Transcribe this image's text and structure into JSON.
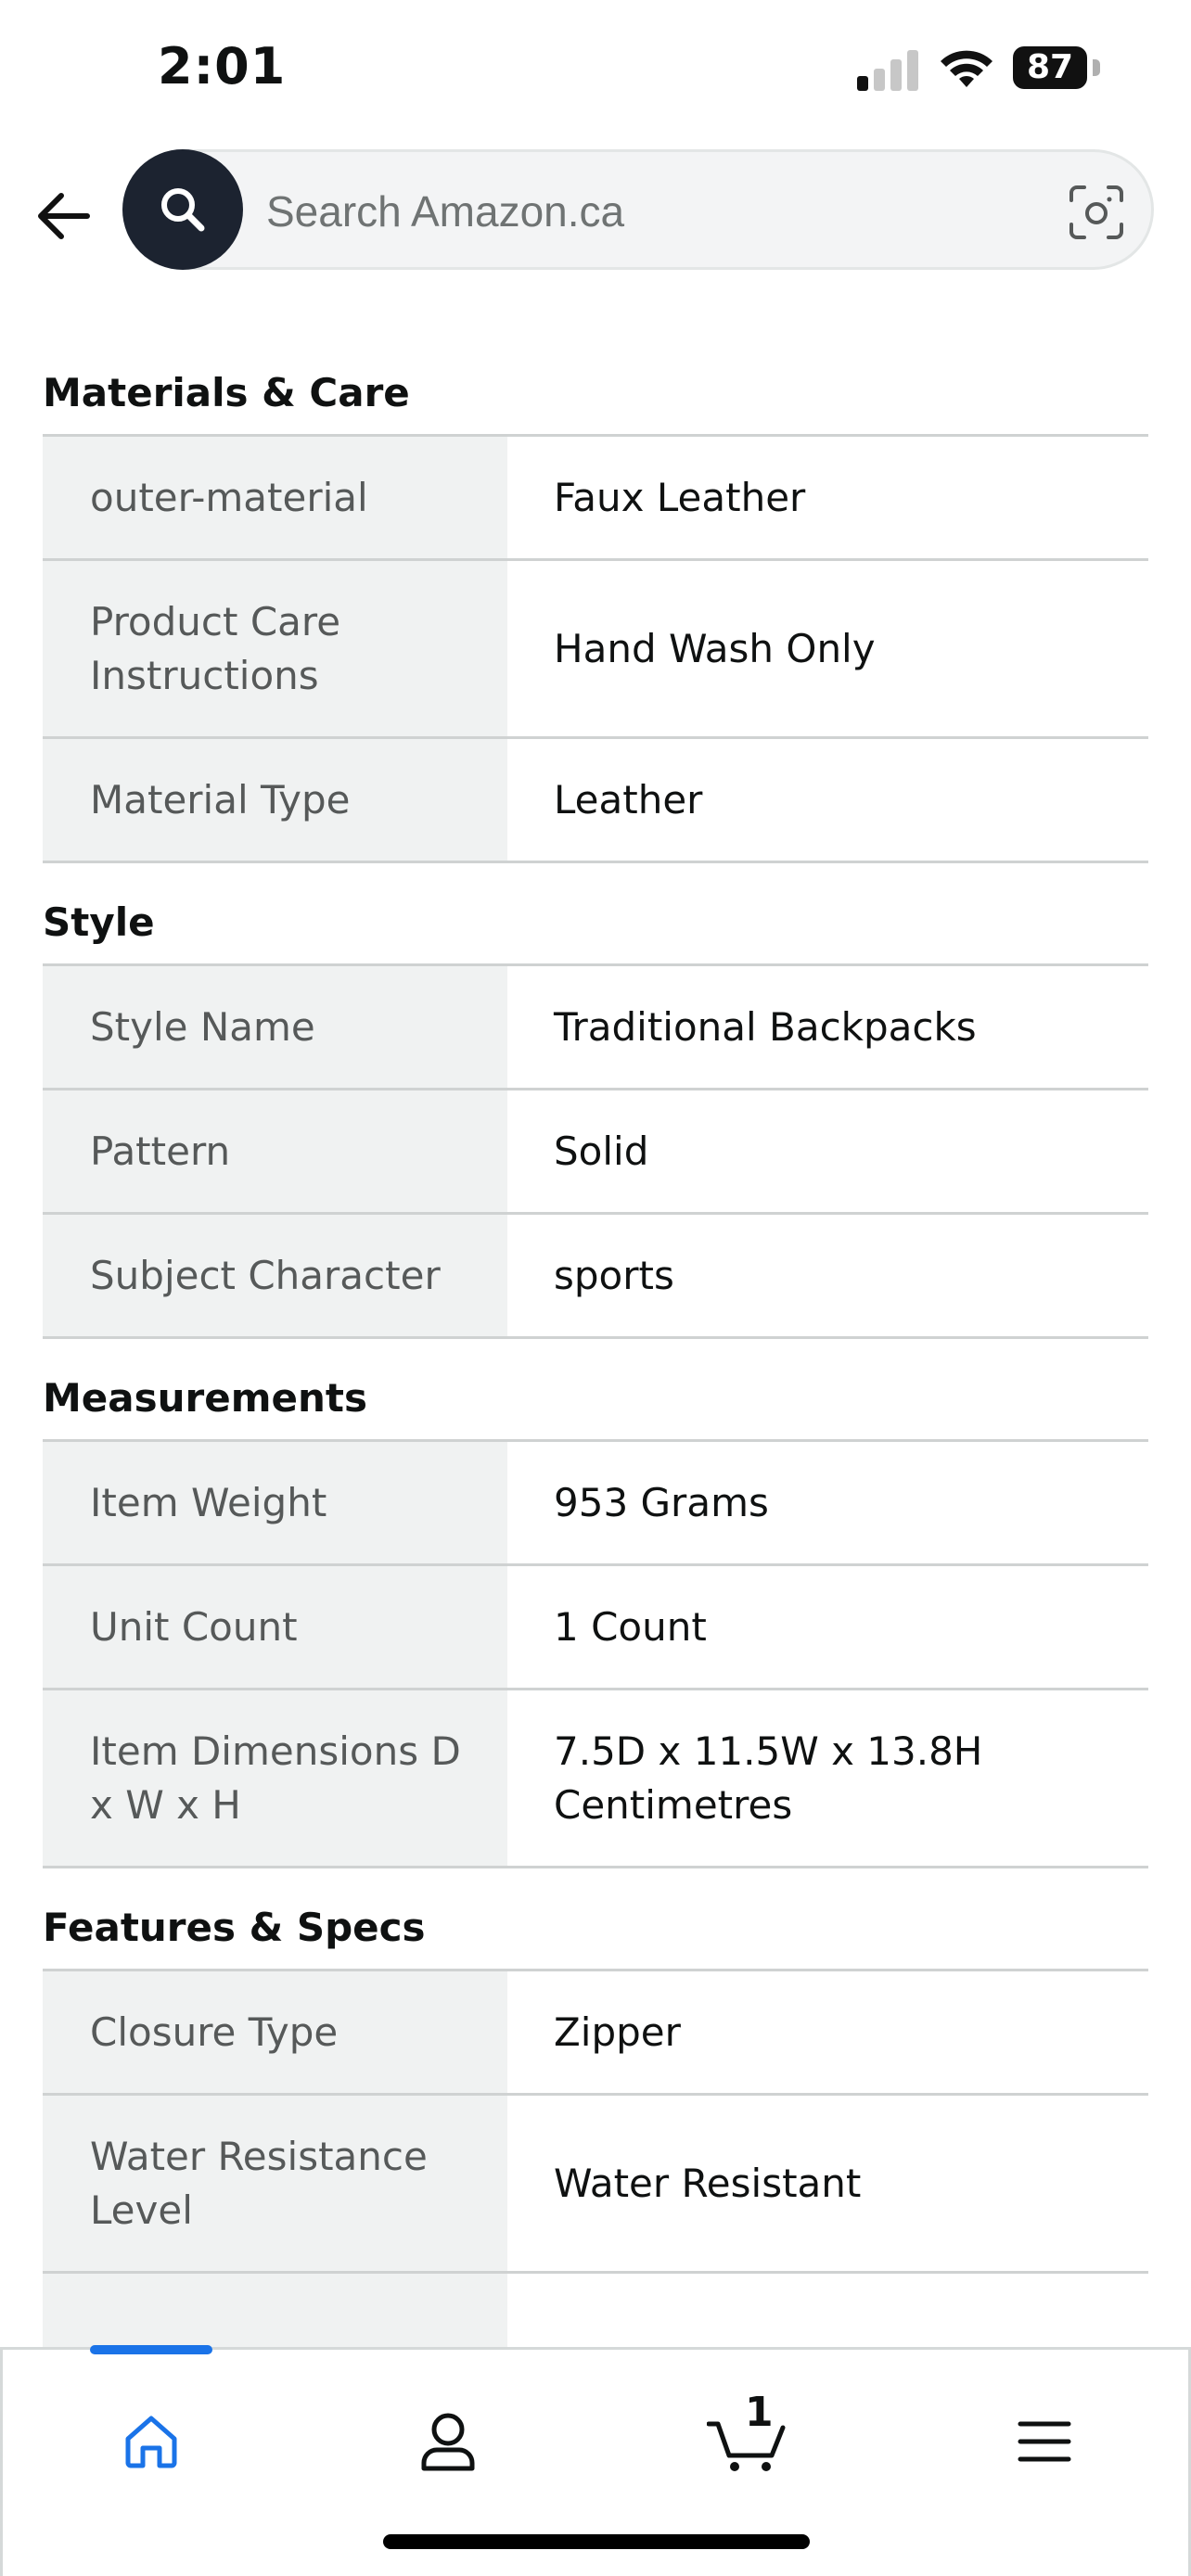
{
  "status_bar": {
    "time": "2:01",
    "battery": "87"
  },
  "search": {
    "placeholder": "Search Amazon.ca"
  },
  "sections": [
    {
      "title": "Materials & Care",
      "rows": [
        {
          "key": "outer-material",
          "value": "Faux Leather"
        },
        {
          "key": "Product Care Instructions",
          "value": "Hand Wash Only"
        },
        {
          "key": "Material Type",
          "value": "Leather"
        }
      ]
    },
    {
      "title": "Style",
      "rows": [
        {
          "key": "Style Name",
          "value": "Traditional Backpacks"
        },
        {
          "key": "Pattern",
          "value": "Solid"
        },
        {
          "key": "Subject Character",
          "value": "sports"
        }
      ]
    },
    {
      "title": "Measurements",
      "rows": [
        {
          "key": "Item Weight",
          "value": "953 Grams"
        },
        {
          "key": "Unit Count",
          "value": "1 Count"
        },
        {
          "key": "Item Dimensions D x W x H",
          "value": "7.5D x 11.5W x 13.8H Centimetres"
        }
      ]
    },
    {
      "title": "Features & Specs",
      "rows": [
        {
          "key": "Closure Type",
          "value": "Zipper"
        },
        {
          "key": "Water Resistance Level",
          "value": "Water Resistant"
        }
      ]
    }
  ],
  "bottom_nav": {
    "items": [
      {
        "icon": "home-icon",
        "active": true
      },
      {
        "icon": "account-icon",
        "active": false
      },
      {
        "icon": "cart-icon",
        "active": false
      },
      {
        "icon": "menu-icon",
        "active": false
      }
    ],
    "cart_count": "1",
    "active_color": "#1a73e8"
  }
}
